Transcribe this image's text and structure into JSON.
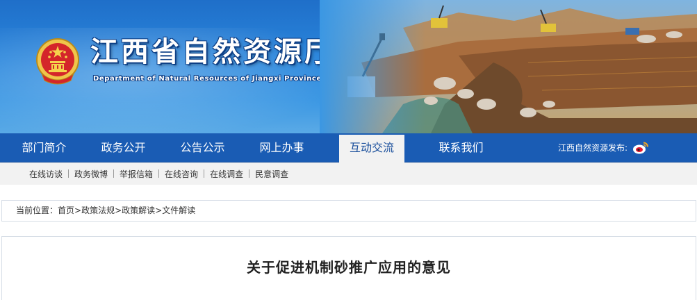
{
  "header": {
    "title": "江西省自然资源厅",
    "subtitle": "Department of Natural Resources of Jiangxi Province"
  },
  "main_nav": {
    "items": [
      {
        "label": "部门简介",
        "active": false
      },
      {
        "label": "政务公开",
        "active": false
      },
      {
        "label": "公告公示",
        "active": false
      },
      {
        "label": "网上办事",
        "active": false
      },
      {
        "label": "互动交流",
        "active": true
      },
      {
        "label": "联系我们",
        "active": false
      }
    ],
    "weibo_label": "江西自然资源发布:",
    "weibo_icon": "weibo-icon"
  },
  "sub_nav": {
    "items": [
      "在线访谈",
      "政务微博",
      "举报信箱",
      "在线咨询",
      "在线调查",
      "民意调查"
    ]
  },
  "breadcrumb": {
    "prefix": "当前位置：",
    "items": [
      "首页",
      "政策法规",
      "政策解读",
      "文件解读"
    ],
    "separator": ">"
  },
  "article": {
    "title": "关于促进机制砂推广应用的意见"
  },
  "colors": {
    "nav_bg": "#1a5cb4",
    "active_tab_text": "#1a4f9c",
    "subnav_bg": "#f2f2f2"
  }
}
